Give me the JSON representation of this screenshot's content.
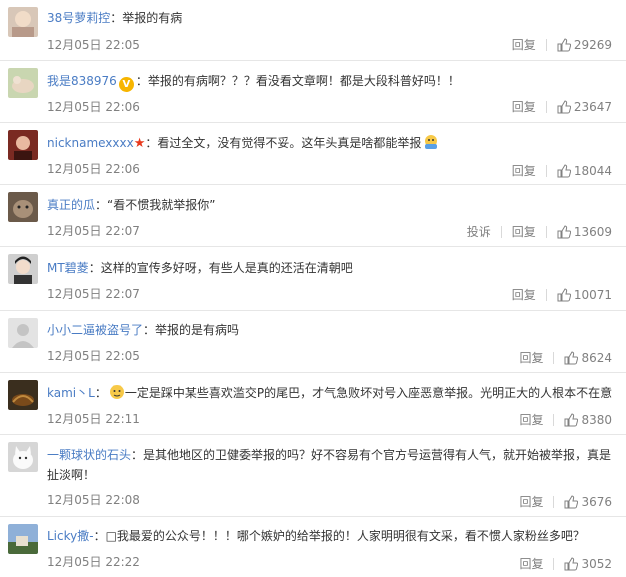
{
  "comments": [
    {
      "user": "38号萝莉控",
      "text": "举报的有病",
      "time": "12月05日 22:05",
      "reply": "回复",
      "likes": "29269"
    },
    {
      "user": "我是838976",
      "text": "举报的有病啊？？？看没看文章啊！都是大段科普好吗！！",
      "time": "12月05日 22:06",
      "reply": "回复",
      "likes": "23647"
    },
    {
      "user": "nicknamexxxx",
      "text": "看过全文，没有觉得不妥。这年头真是啥都能举报",
      "time": "12月05日 22:06",
      "reply": "回复",
      "likes": "18044"
    },
    {
      "user": "真正的瓜",
      "text": "“看不惯我就举报你”",
      "time": "12月05日 22:07",
      "report": "投诉",
      "reply": "回复",
      "likes": "13609"
    },
    {
      "user": "MT碧菱",
      "text": "这样的宣传多好呀，有些人是真的还活在清朝吧",
      "time": "12月05日 22:07",
      "reply": "回复",
      "likes": "10071"
    },
    {
      "user": "小小二逼被盗号了",
      "text": "举报的是有病吗",
      "time": "12月05日 22:05",
      "reply": "回复",
      "likes": "8624"
    },
    {
      "user": "kami丶L",
      "text": "一定是踩中某些喜欢滥交P的尾巴，才气急败坏对号入座恶意举报。光明正大的人根本不在意",
      "time": "12月05日 22:11",
      "reply": "回复",
      "likes": "8380"
    },
    {
      "user": "一颗球状的石头",
      "text": "是其他地区的卫健委举报的吗？好不容易有个官方号运营得有人气，就开始被举报，真是扯淡啊！",
      "time": "12月05日 22:08",
      "reply": "回复",
      "likes": "3676"
    },
    {
      "user": "Licky撒-",
      "text": "□我最爱的公众号！！！哪个嫉妒的给举报的！人家明明很有文采，看不惯人家粉丝多吧？",
      "time": "12月05日 22:22",
      "reply": "回复",
      "likes": "3052"
    }
  ],
  "separator": "：",
  "badge": "V",
  "colors": {
    "username": "#eb7350",
    "link": "#4a7cc4",
    "meta": "#808080"
  }
}
